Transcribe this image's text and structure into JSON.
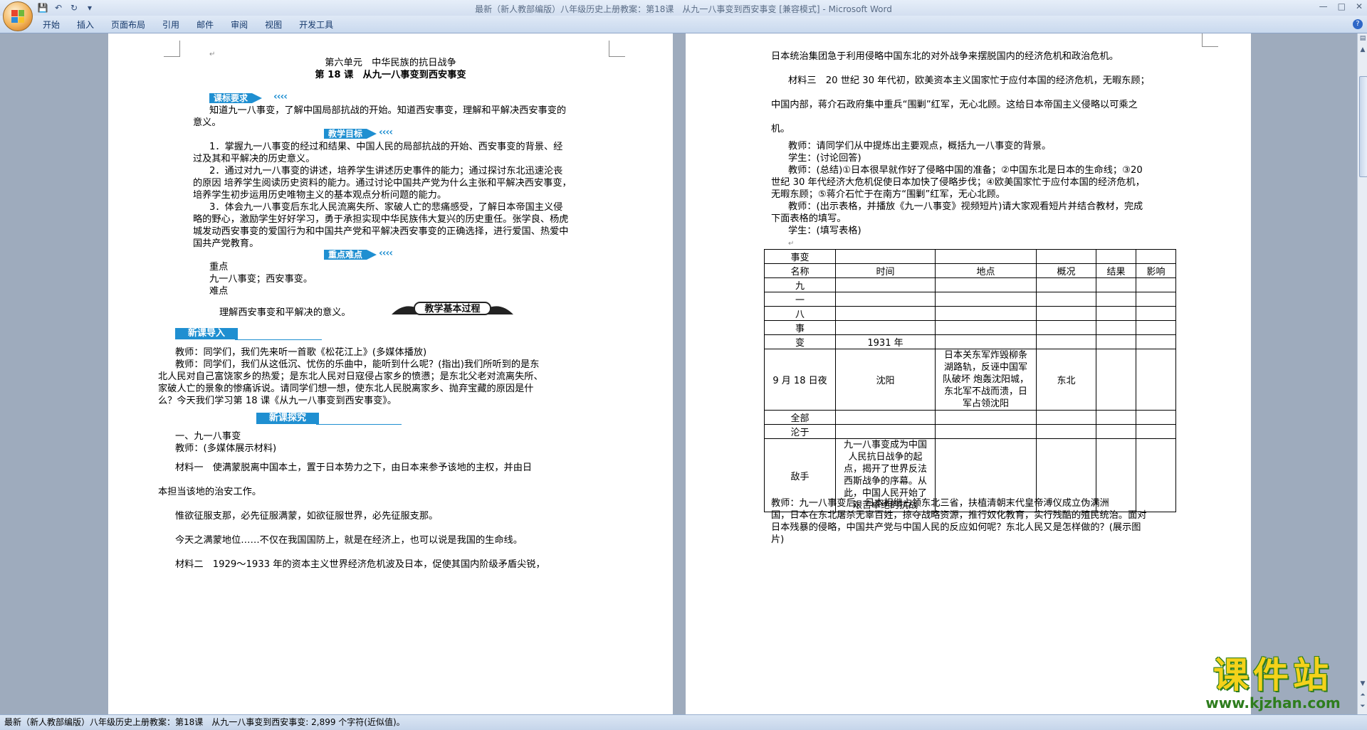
{
  "window": {
    "title": "最新（新人教部编版）八年级历史上册教案：第18课　从九一八事变到西安事变 [兼容模式] - Microsoft Word",
    "controls": [
      "—",
      "□",
      "✕"
    ]
  },
  "ribbon": {
    "tabs": [
      "开始",
      "插入",
      "页面布局",
      "引用",
      "邮件",
      "审阅",
      "视图",
      "开发工具"
    ],
    "help": "?"
  },
  "page1": {
    "unit_title": "第六单元　中华民族的抗日战争",
    "lesson_title": "第 18 课　从九一八事变到西安事变",
    "sec_requirements": "课标要求",
    "req_text_1": "知道九一八事变，了解中国局部抗战的开始。知道西安事变，理解和平解决西安事变的",
    "req_text_2": "意义。",
    "sec_goals": "教学目标",
    "goal1_1": "1．掌握九一八事变的经过和结果、中国人民的局部抗战的开始、西安事变的背景、经",
    "goal1_2": "过及其和平解决的历史意义。",
    "goal2_1": "2．通过对九一八事变的讲述，培养学生讲述历史事件的能力；通过探讨东北迅速沦丧",
    "goal2_2": "的原因  培养学生阅读历史资料的能力。通过讨论中国共产党为什么主张和平解决西安事变，",
    "goal2_3": "培养学生初步运用历史唯物主义的基本观点分析问题的能力。",
    "goal3_1": "3．体会九一八事变后东北人民流离失所、家破人亡的悲痛感受，了解日本帝国主义侵",
    "goal3_2": "略的野心，激励学生好好学习，勇于承担实现中华民族伟大复兴的历史重任。张学良、杨虎",
    "goal3_3": "城发动西安事变的爱国行为和中国共产党和平解决西安事变的正确选择，进行爱国、热爱中",
    "goal3_4": "国共产党教育。",
    "sec_key": "重点难点",
    "key_label": "重点",
    "key_text": "九一八事变；西安事变。",
    "diff_label": "难点",
    "diff_text": "理解西安事变和平解决的意义。",
    "banner_text": "教学基本过程",
    "sec_intro": "新课导入",
    "intro_1": "教师：同学们，我们先来听一首歌《松花江上》(多媒体播放)",
    "intro_2": "教师：同学们，我们从这低沉、忧伤的乐曲中，能听到什么呢？(指出)我们所听到的是东",
    "intro_3": "北人民对自己富饶家乡的热爱；是东北人民对日寇侵占家乡的愤懑；是东北父老对流离失所、",
    "intro_4": "家破人亡的景象的惨痛诉说。请同学们想一想，使东北人民脱离家乡、抛弃宝藏的原因是什",
    "intro_5": "么？今天我们学习第 18 课《从九一八事变到西安事变》。",
    "sec_explore": "新课探究",
    "exp_1": "一、九一八事变",
    "exp_2": "教师：(多媒体展示材料)",
    "mat1_1": "材料一　使满蒙脱离中国本土，置于日本势力之下，由日本来参予该地的主权，并由日",
    "mat1_2": "本担当该地的治安工作。",
    "mat1_3": "惟欲征服支那，必先征服满蒙，如欲征服世界，必先征服支那。",
    "mat1_4": "今天之满蒙地位……不仅在我国国防上，就是在经济上，也可以说是我国的生命线。",
    "mat2_1": "材料二　1929～1933 年的资本主义世界经济危机波及日本，促使其国内阶级矛盾尖锐，"
  },
  "page2": {
    "l1": "日本统治集团急于利用侵略中国东北的对外战争来摆脱国内的经济危机和政治危机。",
    "l2": "材料三　20 世纪 30 年代初，欧美资本主义国家忙于应付本国的经济危机，无暇东顾；",
    "l3": "中国内部，蒋介石政府集中重兵“围剿”红军，无心北顾。这给日本帝国主义侵略以可乘之",
    "l4": "机。",
    "l5": "教师：请同学们从中提炼出主要观点，概括九一八事变的背景。",
    "l6": "学生：(讨论回答)",
    "l7": "教师：(总结)①日本很早就作好了侵略中国的准备；②中国东北是日本的生命线；③20",
    "l8": "世纪 30 年代经济大危机促使日本加快了侵略步伐；④欧美国家忙于应付本国的经济危机，",
    "l9": "无暇东顾；⑤蒋介石忙于在南方“围剿”红军，无心北顾。",
    "l10": "教师：(出示表格，并播放《九一八事变》视频短片)请大家观看短片并结合教材，完成",
    "l11": "下面表格的填写。",
    "l12": "学生：(填写表格)",
    "table": {
      "head_event": "事变",
      "cols": [
        "名称",
        "时间",
        "地点",
        "概况",
        "结果",
        "影响"
      ],
      "row_labels": [
        "九",
        "一",
        "八",
        "事",
        "变"
      ],
      "time_year": "1931 年",
      "time_date": "9 月 18 日夜",
      "place": "沈阳",
      "overview": "日本关东军炸毁柳条湖路轨，反诬中国军队破坏 炮轰沈阳城，东北军不战而溃，日军占领沈阳",
      "overview_lines": [
        "日本关东军炸毁柳条",
        "湖路轨，反诬中国军",
        "队破坏 炮轰沈阳城，",
        "东北军不战而溃，日",
        "军占领沈阳"
      ],
      "result": "东北",
      "row_all": "全部",
      "row_fall": "沦于",
      "row_enemy": "敌手",
      "impact_lines": [
        "九一八事变成为中国",
        "人民抗日战争的起",
        "点，揭开了世界反法",
        "西斯战争的序幕。从",
        "此，中国人民开始了",
        "艰苦卓绝的抗战"
      ]
    },
    "p_1": "教师：九一八事变后，日本相继占领东北三省，扶植清朝末代皇帝溥仪成立伪满洲",
    "p_2": "国，日本在东北屠杀无辜百姓，掠夺战略资源，推行奴化教育，实行残酷的殖民统治。面对",
    "p_3": "日本残暴的侵略，中国共产党与中国人民的反应如何呢？东北人民又是怎样做的？(展示图",
    "p_4": "片)"
  },
  "statusbar": {
    "text": "最新（新人教部编版）八年级历史上册教案：第18课　从九一八事变到西安事变: 2,899 个字符(近似值)。"
  },
  "watermark": {
    "text": "课件站",
    "url": "www.kjzhan.com"
  },
  "colors": {
    "accent": "#1f8fd1",
    "watermark_yellow": "#f4d21a",
    "watermark_green": "#2e7d1e"
  }
}
